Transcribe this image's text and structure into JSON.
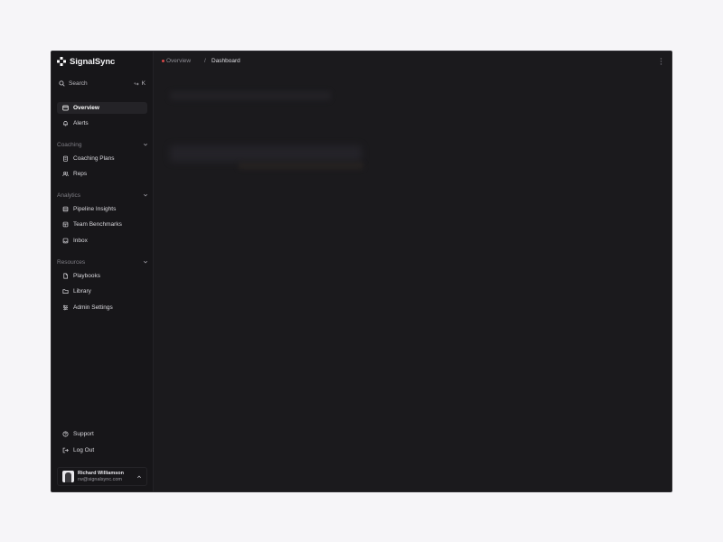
{
  "app": {
    "name": "SignalSync"
  },
  "search": {
    "label": "Search",
    "shortcut_symbol": "↪",
    "shortcut_key": "K"
  },
  "nav_top": [
    {
      "label": "Overview",
      "icon": "window-icon",
      "active": true
    },
    {
      "label": "Alerts",
      "icon": "bell-icon",
      "active": false
    }
  ],
  "sections": [
    {
      "title": "Coaching",
      "items": [
        {
          "label": "Coaching Plans",
          "icon": "clipboard-icon"
        },
        {
          "label": "Reps",
          "icon": "users-icon"
        }
      ]
    },
    {
      "title": "Analytics",
      "items": [
        {
          "label": "Pipeline Insights",
          "icon": "database-icon"
        },
        {
          "label": "Team Benchmarks",
          "icon": "table-icon"
        },
        {
          "label": "Inbox",
          "icon": "inbox-icon"
        }
      ]
    },
    {
      "title": "Resources",
      "items": [
        {
          "label": "Playbooks",
          "icon": "file-icon"
        },
        {
          "label": "Library",
          "icon": "folder-icon"
        },
        {
          "label": "Admin Settings",
          "icon": "sliders-icon"
        }
      ]
    }
  ],
  "footer_nav": [
    {
      "label": "Support",
      "icon": "help-circle-icon"
    },
    {
      "label": "Log Out",
      "icon": "logout-icon"
    }
  ],
  "user": {
    "name": "Richard Williamson",
    "email": "rw@signalsync.com"
  },
  "breadcrumb": {
    "parent": "Overview",
    "separator": "/",
    "current": "Dashboard"
  },
  "colors": {
    "accent_dot": "#d64848",
    "background": "#1b1a1d",
    "sidebar": "#171619"
  }
}
